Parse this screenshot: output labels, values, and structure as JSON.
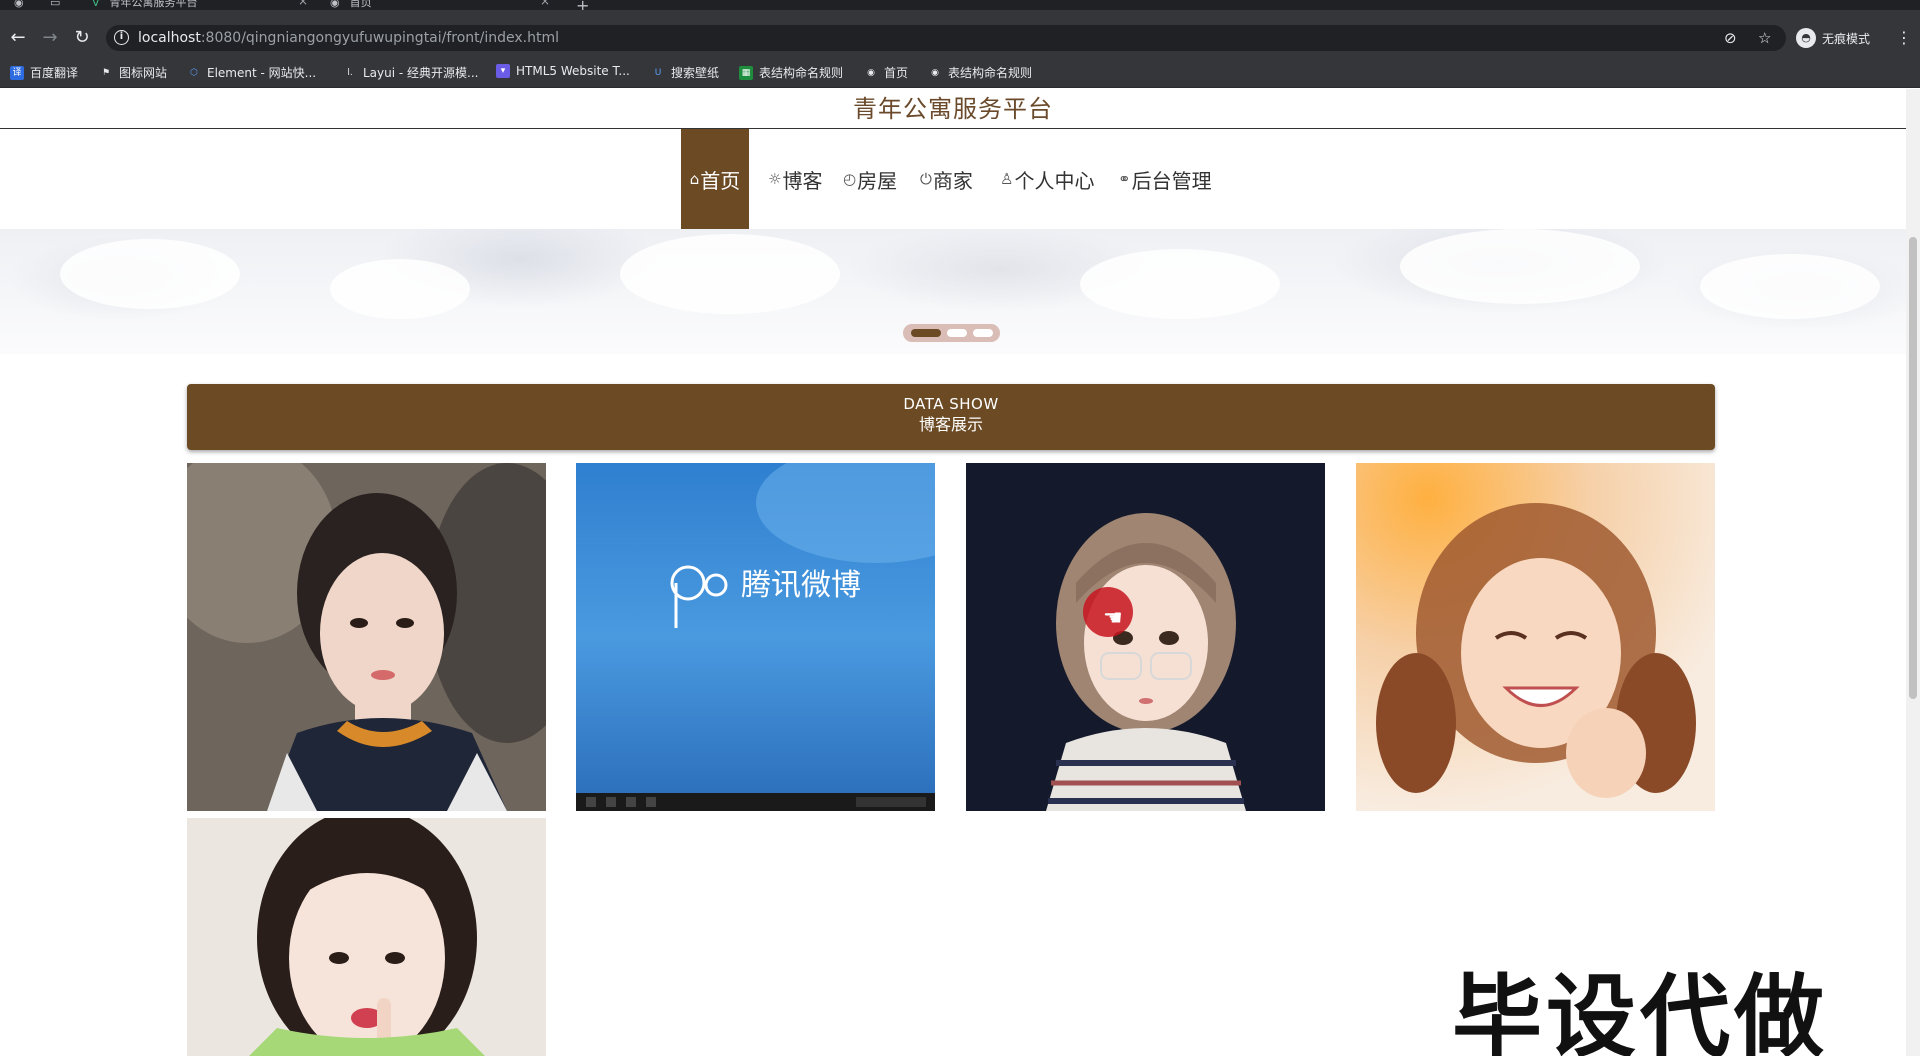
{
  "browser": {
    "tabs": [
      {
        "title": "青年公寓服务平台",
        "icon": "vue-icon"
      },
      {
        "title": "首页",
        "icon": "globe-icon"
      }
    ],
    "new_tab_symbol": "+",
    "url_host": "localhost",
    "url_rest": ":8080/qingniangongyufuwupingtai/front/index.html",
    "profile_label": "无痕模式",
    "bookmarks": [
      {
        "label": "百度翻译",
        "icon": "translate-icon"
      },
      {
        "label": "图标网站",
        "icon": "flag-icon"
      },
      {
        "label": "Element - 网站快...",
        "icon": "element-icon"
      },
      {
        "label": "Layui - 经典开源模...",
        "icon": "layui-icon"
      },
      {
        "label": "HTML5 Website T...",
        "icon": "html5-icon"
      },
      {
        "label": "搜索壁纸",
        "icon": "wallpaper-icon"
      },
      {
        "label": "表结构命名规则",
        "icon": "sheet-icon"
      },
      {
        "label": "首页",
        "icon": "globe-icon"
      },
      {
        "label": "表结构命名规则",
        "icon": "globe-icon"
      }
    ]
  },
  "site": {
    "title": "青年公寓服务平台",
    "nav": [
      {
        "label": "首页",
        "icon": "home-icon",
        "glyph": "⌂",
        "active": true
      },
      {
        "label": "博客",
        "icon": "blog-icon",
        "glyph": "☼",
        "active": false
      },
      {
        "label": "房屋",
        "icon": "dashboard-icon",
        "glyph": "◴",
        "active": false
      },
      {
        "label": "商家",
        "icon": "power-icon",
        "glyph": "⏻",
        "active": false
      },
      {
        "label": "个人中心",
        "icon": "user-icon",
        "glyph": "♙",
        "active": false
      },
      {
        "label": "后台管理",
        "icon": "link-icon",
        "glyph": "⚭",
        "active": false
      }
    ],
    "carousel": {
      "slides": 3,
      "active_index": 0
    },
    "section": {
      "title_en": "DATA SHOW",
      "title_zh": "博客展示"
    },
    "blog_cards": [
      {
        "image": "photo-girl-on-rocks"
      },
      {
        "image": "tencent-weibo-screenshot",
        "logo_text": "腾讯微博"
      },
      {
        "image": "illustrated-girl-with-glasses"
      },
      {
        "image": "photo-smiling-girl-pigtails"
      },
      {
        "image": "photo-girl-finger-on-lips"
      }
    ],
    "watermark": "毕设代做"
  },
  "colors": {
    "brand_brown": "#6b4a24",
    "chrome_dark": "#35363a"
  }
}
